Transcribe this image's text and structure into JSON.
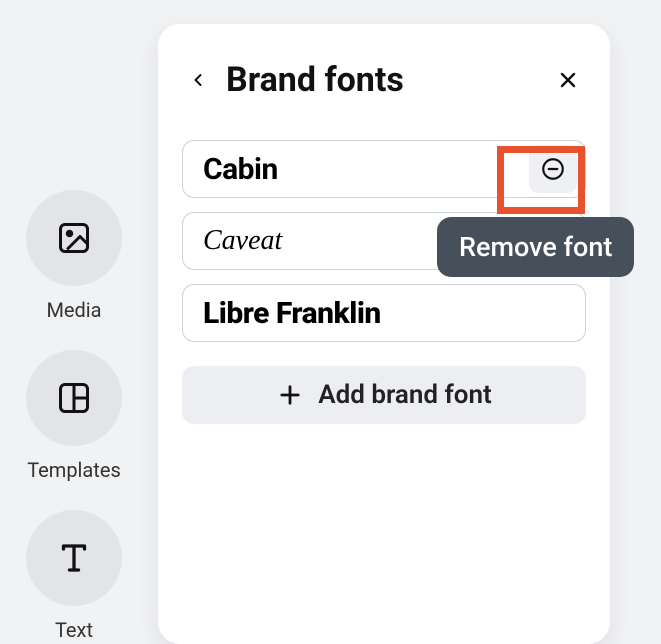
{
  "sidebar": {
    "items": [
      {
        "label": "Media"
      },
      {
        "label": "Templates"
      },
      {
        "label": "Text"
      }
    ]
  },
  "panel": {
    "title": "Brand fonts",
    "fonts": [
      {
        "name": "Cabin"
      },
      {
        "name": "Caveat"
      },
      {
        "name": "Libre Franklin"
      }
    ],
    "add_label": "Add brand font",
    "remove_tooltip": "Remove font"
  }
}
